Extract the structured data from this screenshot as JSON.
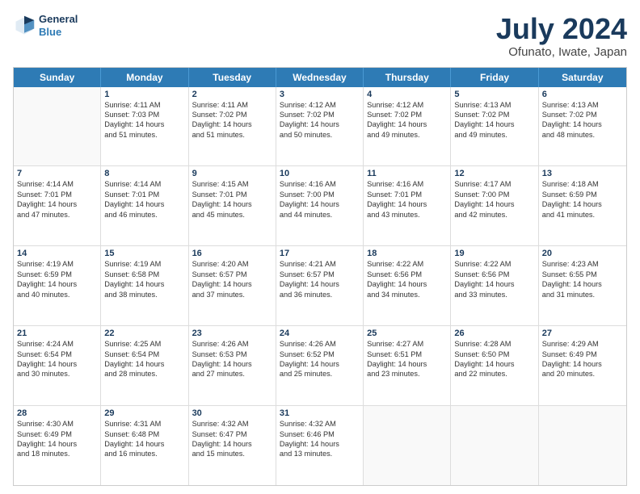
{
  "logo": {
    "line1": "General",
    "line2": "Blue"
  },
  "title": "July 2024",
  "subtitle": "Ofunato, Iwate, Japan",
  "header_days": [
    "Sunday",
    "Monday",
    "Tuesday",
    "Wednesday",
    "Thursday",
    "Friday",
    "Saturday"
  ],
  "weeks": [
    [
      {
        "day": "",
        "sunrise": "",
        "sunset": "",
        "daylight": ""
      },
      {
        "day": "1",
        "sunrise": "Sunrise: 4:11 AM",
        "sunset": "Sunset: 7:03 PM",
        "daylight": "Daylight: 14 hours",
        "daylight2": "and 51 minutes."
      },
      {
        "day": "2",
        "sunrise": "Sunrise: 4:11 AM",
        "sunset": "Sunset: 7:02 PM",
        "daylight": "Daylight: 14 hours",
        "daylight2": "and 51 minutes."
      },
      {
        "day": "3",
        "sunrise": "Sunrise: 4:12 AM",
        "sunset": "Sunset: 7:02 PM",
        "daylight": "Daylight: 14 hours",
        "daylight2": "and 50 minutes."
      },
      {
        "day": "4",
        "sunrise": "Sunrise: 4:12 AM",
        "sunset": "Sunset: 7:02 PM",
        "daylight": "Daylight: 14 hours",
        "daylight2": "and 49 minutes."
      },
      {
        "day": "5",
        "sunrise": "Sunrise: 4:13 AM",
        "sunset": "Sunset: 7:02 PM",
        "daylight": "Daylight: 14 hours",
        "daylight2": "and 49 minutes."
      },
      {
        "day": "6",
        "sunrise": "Sunrise: 4:13 AM",
        "sunset": "Sunset: 7:02 PM",
        "daylight": "Daylight: 14 hours",
        "daylight2": "and 48 minutes."
      }
    ],
    [
      {
        "day": "7",
        "sunrise": "Sunrise: 4:14 AM",
        "sunset": "Sunset: 7:01 PM",
        "daylight": "Daylight: 14 hours",
        "daylight2": "and 47 minutes."
      },
      {
        "day": "8",
        "sunrise": "Sunrise: 4:14 AM",
        "sunset": "Sunset: 7:01 PM",
        "daylight": "Daylight: 14 hours",
        "daylight2": "and 46 minutes."
      },
      {
        "day": "9",
        "sunrise": "Sunrise: 4:15 AM",
        "sunset": "Sunset: 7:01 PM",
        "daylight": "Daylight: 14 hours",
        "daylight2": "and 45 minutes."
      },
      {
        "day": "10",
        "sunrise": "Sunrise: 4:16 AM",
        "sunset": "Sunset: 7:00 PM",
        "daylight": "Daylight: 14 hours",
        "daylight2": "and 44 minutes."
      },
      {
        "day": "11",
        "sunrise": "Sunrise: 4:16 AM",
        "sunset": "Sunset: 7:01 PM",
        "daylight": "Daylight: 14 hours",
        "daylight2": "and 43 minutes."
      },
      {
        "day": "12",
        "sunrise": "Sunrise: 4:17 AM",
        "sunset": "Sunset: 7:00 PM",
        "daylight": "Daylight: 14 hours",
        "daylight2": "and 42 minutes."
      },
      {
        "day": "13",
        "sunrise": "Sunrise: 4:18 AM",
        "sunset": "Sunset: 6:59 PM",
        "daylight": "Daylight: 14 hours",
        "daylight2": "and 41 minutes."
      }
    ],
    [
      {
        "day": "14",
        "sunrise": "Sunrise: 4:19 AM",
        "sunset": "Sunset: 6:59 PM",
        "daylight": "Daylight: 14 hours",
        "daylight2": "and 40 minutes."
      },
      {
        "day": "15",
        "sunrise": "Sunrise: 4:19 AM",
        "sunset": "Sunset: 6:58 PM",
        "daylight": "Daylight: 14 hours",
        "daylight2": "and 38 minutes."
      },
      {
        "day": "16",
        "sunrise": "Sunrise: 4:20 AM",
        "sunset": "Sunset: 6:57 PM",
        "daylight": "Daylight: 14 hours",
        "daylight2": "and 37 minutes."
      },
      {
        "day": "17",
        "sunrise": "Sunrise: 4:21 AM",
        "sunset": "Sunset: 6:57 PM",
        "daylight": "Daylight: 14 hours",
        "daylight2": "and 36 minutes."
      },
      {
        "day": "18",
        "sunrise": "Sunrise: 4:22 AM",
        "sunset": "Sunset: 6:56 PM",
        "daylight": "Daylight: 14 hours",
        "daylight2": "and 34 minutes."
      },
      {
        "day": "19",
        "sunrise": "Sunrise: 4:22 AM",
        "sunset": "Sunset: 6:56 PM",
        "daylight": "Daylight: 14 hours",
        "daylight2": "and 33 minutes."
      },
      {
        "day": "20",
        "sunrise": "Sunrise: 4:23 AM",
        "sunset": "Sunset: 6:55 PM",
        "daylight": "Daylight: 14 hours",
        "daylight2": "and 31 minutes."
      }
    ],
    [
      {
        "day": "21",
        "sunrise": "Sunrise: 4:24 AM",
        "sunset": "Sunset: 6:54 PM",
        "daylight": "Daylight: 14 hours",
        "daylight2": "and 30 minutes."
      },
      {
        "day": "22",
        "sunrise": "Sunrise: 4:25 AM",
        "sunset": "Sunset: 6:54 PM",
        "daylight": "Daylight: 14 hours",
        "daylight2": "and 28 minutes."
      },
      {
        "day": "23",
        "sunrise": "Sunrise: 4:26 AM",
        "sunset": "Sunset: 6:53 PM",
        "daylight": "Daylight: 14 hours",
        "daylight2": "and 27 minutes."
      },
      {
        "day": "24",
        "sunrise": "Sunrise: 4:26 AM",
        "sunset": "Sunset: 6:52 PM",
        "daylight": "Daylight: 14 hours",
        "daylight2": "and 25 minutes."
      },
      {
        "day": "25",
        "sunrise": "Sunrise: 4:27 AM",
        "sunset": "Sunset: 6:51 PM",
        "daylight": "Daylight: 14 hours",
        "daylight2": "and 23 minutes."
      },
      {
        "day": "26",
        "sunrise": "Sunrise: 4:28 AM",
        "sunset": "Sunset: 6:50 PM",
        "daylight": "Daylight: 14 hours",
        "daylight2": "and 22 minutes."
      },
      {
        "day": "27",
        "sunrise": "Sunrise: 4:29 AM",
        "sunset": "Sunset: 6:49 PM",
        "daylight": "Daylight: 14 hours",
        "daylight2": "and 20 minutes."
      }
    ],
    [
      {
        "day": "28",
        "sunrise": "Sunrise: 4:30 AM",
        "sunset": "Sunset: 6:49 PM",
        "daylight": "Daylight: 14 hours",
        "daylight2": "and 18 minutes."
      },
      {
        "day": "29",
        "sunrise": "Sunrise: 4:31 AM",
        "sunset": "Sunset: 6:48 PM",
        "daylight": "Daylight: 14 hours",
        "daylight2": "and 16 minutes."
      },
      {
        "day": "30",
        "sunrise": "Sunrise: 4:32 AM",
        "sunset": "Sunset: 6:47 PM",
        "daylight": "Daylight: 14 hours",
        "daylight2": "and 15 minutes."
      },
      {
        "day": "31",
        "sunrise": "Sunrise: 4:32 AM",
        "sunset": "Sunset: 6:46 PM",
        "daylight": "Daylight: 14 hours",
        "daylight2": "and 13 minutes."
      },
      {
        "day": "",
        "sunrise": "",
        "sunset": "",
        "daylight": "",
        "daylight2": ""
      },
      {
        "day": "",
        "sunrise": "",
        "sunset": "",
        "daylight": "",
        "daylight2": ""
      },
      {
        "day": "",
        "sunrise": "",
        "sunset": "",
        "daylight": "",
        "daylight2": ""
      }
    ]
  ]
}
